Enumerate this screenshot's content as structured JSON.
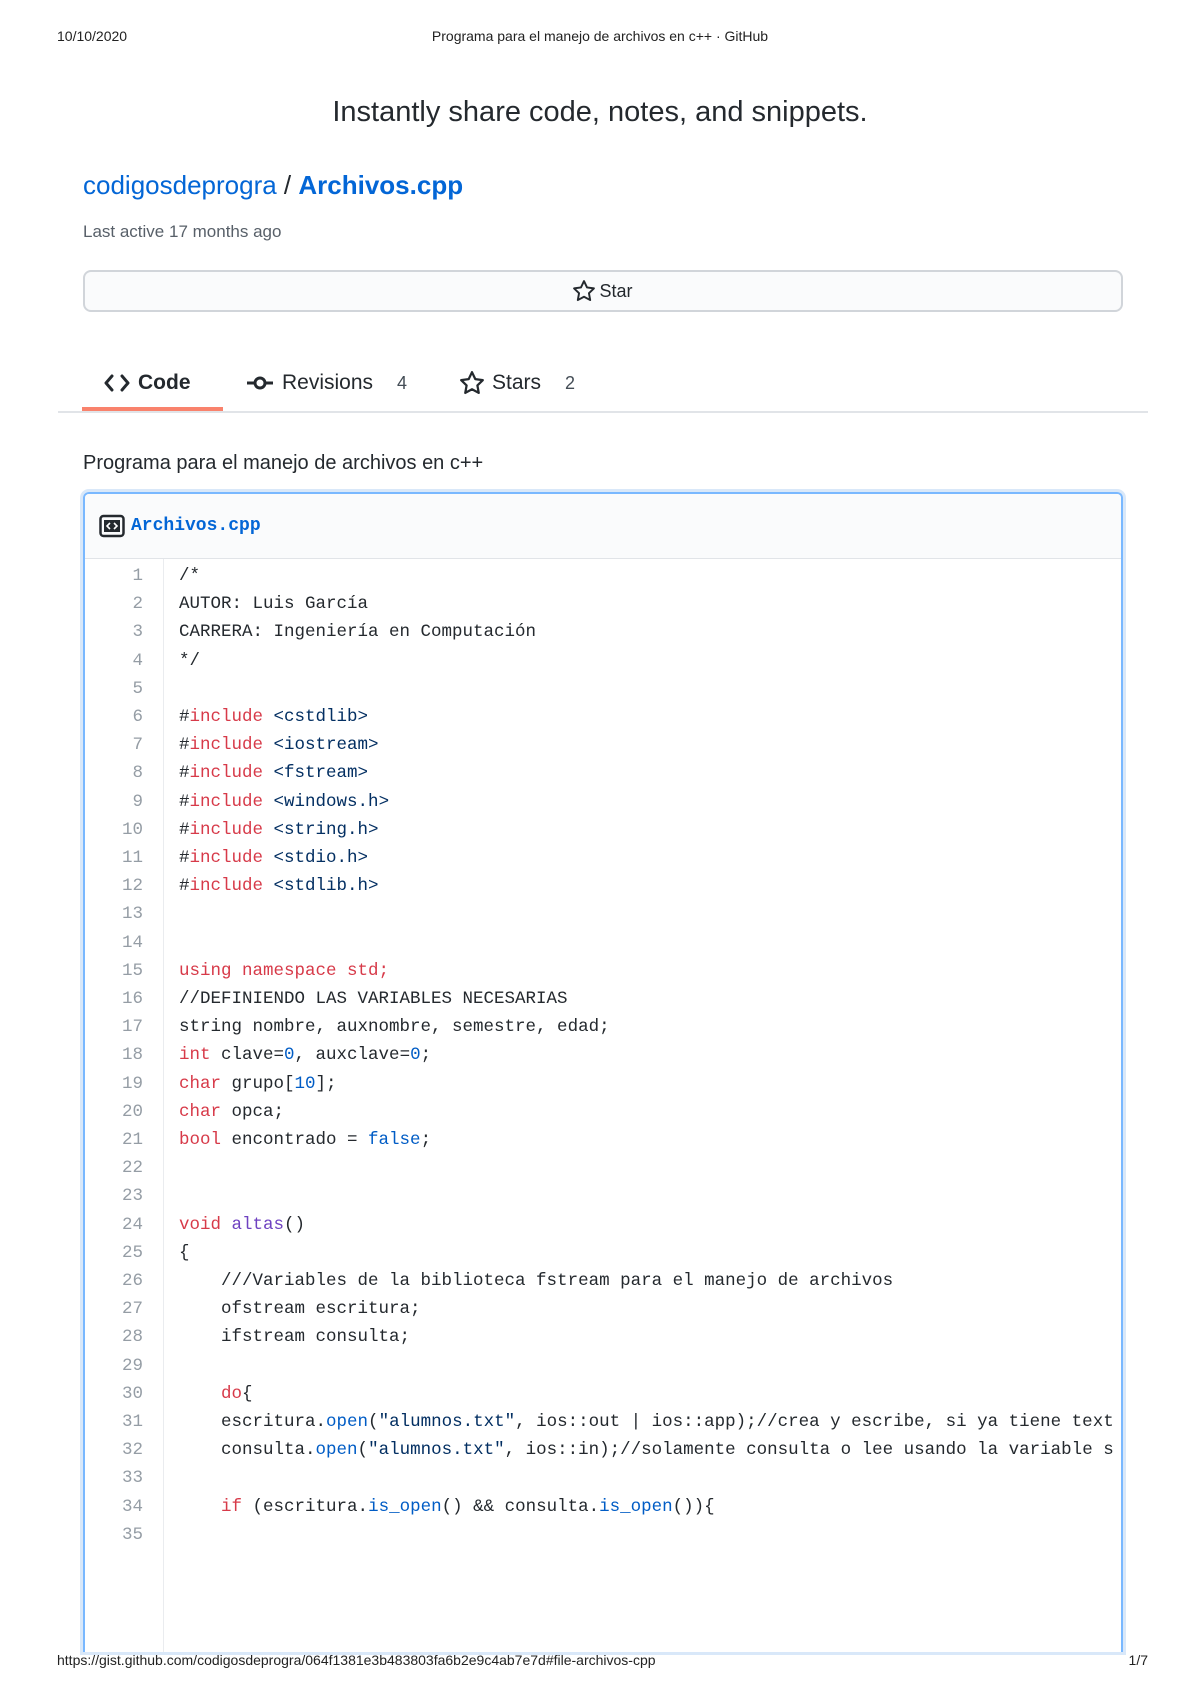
{
  "print_header": {
    "date": "10/10/2020",
    "title": "Programa para el manejo de archivos en c++ · GitHub"
  },
  "print_footer": {
    "url": "https://gist.github.com/codigosdeprogra/064f1381e3b483803fa6b2e9c4ab7e7d#file-archivos-cpp",
    "page": "1/7"
  },
  "tagline": "Instantly share code, notes, and snippets.",
  "gist": {
    "owner": "codigosdeprogra",
    "separator": " / ",
    "filename": "Archivos.cpp",
    "last_active": "Last active 17 months ago"
  },
  "star_button": {
    "label": "Star",
    "icon": "star-icon"
  },
  "tabs": [
    {
      "label": "Code",
      "icon": "code-icon",
      "count": ""
    },
    {
      "label": "Revisions",
      "icon": "git-commit-icon",
      "count": "4"
    },
    {
      "label": "Stars",
      "icon": "star-icon",
      "count": "2"
    }
  ],
  "description": "Programa para el manejo de archivos en c++",
  "file": {
    "name": "Archivos.cpp",
    "icon": "file-code-icon"
  },
  "colors": {
    "link": "#0366d6",
    "keyword": "#d73a49",
    "string": "#032f62",
    "tab_underline": "#f9826c",
    "focus_border": "#79b8ff"
  },
  "code_lines": [
    {
      "n": "1",
      "t": [
        [
          "c",
          "/*"
        ]
      ]
    },
    {
      "n": "2",
      "t": [
        [
          "c",
          "AUTOR: Luis García"
        ]
      ]
    },
    {
      "n": "3",
      "t": [
        [
          "c",
          "CARRERA: Ingeniería en Computación"
        ]
      ]
    },
    {
      "n": "4",
      "t": [
        [
          "c",
          "*/"
        ]
      ]
    },
    {
      "n": "5",
      "t": []
    },
    {
      "n": "6",
      "t": [
        [
          "c",
          "#"
        ],
        [
          "k",
          "include"
        ],
        [
          "c",
          " "
        ],
        [
          "s",
          "<cstdlib>"
        ]
      ]
    },
    {
      "n": "7",
      "t": [
        [
          "c",
          "#"
        ],
        [
          "k",
          "include"
        ],
        [
          "c",
          " "
        ],
        [
          "s",
          "<iostream>"
        ]
      ]
    },
    {
      "n": "8",
      "t": [
        [
          "c",
          "#"
        ],
        [
          "k",
          "include"
        ],
        [
          "c",
          " "
        ],
        [
          "s",
          "<fstream>"
        ]
      ]
    },
    {
      "n": "9",
      "t": [
        [
          "c",
          "#"
        ],
        [
          "k",
          "include"
        ],
        [
          "c",
          " "
        ],
        [
          "s",
          "<windows.h>"
        ]
      ]
    },
    {
      "n": "10",
      "t": [
        [
          "c",
          "#"
        ],
        [
          "k",
          "include"
        ],
        [
          "c",
          " "
        ],
        [
          "s",
          "<string.h>"
        ]
      ]
    },
    {
      "n": "11",
      "t": [
        [
          "c",
          "#"
        ],
        [
          "k",
          "include"
        ],
        [
          "c",
          " "
        ],
        [
          "s",
          "<stdio.h>"
        ]
      ]
    },
    {
      "n": "12",
      "t": [
        [
          "c",
          "#"
        ],
        [
          "k",
          "include"
        ],
        [
          "c",
          " "
        ],
        [
          "s",
          "<stdlib.h>"
        ]
      ]
    },
    {
      "n": "13",
      "t": []
    },
    {
      "n": "14",
      "t": []
    },
    {
      "n": "15",
      "t": [
        [
          "k",
          "using namespace std;"
        ]
      ]
    },
    {
      "n": "16",
      "t": [
        [
          "c",
          "//DEFINIENDO LAS VARIABLES NECESARIAS"
        ]
      ]
    },
    {
      "n": "17",
      "t": [
        [
          "c",
          "string nombre, auxnombre, semestre, edad;"
        ]
      ]
    },
    {
      "n": "18",
      "t": [
        [
          "k",
          "int"
        ],
        [
          "c",
          " clave="
        ],
        [
          "n",
          "0"
        ],
        [
          "c",
          ", auxclave="
        ],
        [
          "n",
          "0"
        ],
        [
          "c",
          ";"
        ]
      ]
    },
    {
      "n": "19",
      "t": [
        [
          "k",
          "char"
        ],
        [
          "c",
          " grupo["
        ],
        [
          "n",
          "10"
        ],
        [
          "c",
          "];"
        ]
      ]
    },
    {
      "n": "20",
      "t": [
        [
          "k",
          "char"
        ],
        [
          "c",
          " opca;"
        ]
      ]
    },
    {
      "n": "21",
      "t": [
        [
          "k",
          "bool"
        ],
        [
          "c",
          " encontrado = "
        ],
        [
          "n",
          "false"
        ],
        [
          "c",
          ";"
        ]
      ]
    },
    {
      "n": "22",
      "t": []
    },
    {
      "n": "23",
      "t": []
    },
    {
      "n": "24",
      "t": [
        [
          "k",
          "void"
        ],
        [
          "c",
          " "
        ],
        [
          "f",
          "altas"
        ],
        [
          "c",
          "()"
        ]
      ]
    },
    {
      "n": "25",
      "t": [
        [
          "c",
          "{"
        ]
      ]
    },
    {
      "n": "26",
      "t": [
        [
          "c",
          "    ///Variables de la biblioteca fstream para el manejo de archivos"
        ]
      ]
    },
    {
      "n": "27",
      "t": [
        [
          "c",
          "    ofstream escritura;"
        ]
      ]
    },
    {
      "n": "28",
      "t": [
        [
          "c",
          "    ifstream consulta;"
        ]
      ]
    },
    {
      "n": "29",
      "t": []
    },
    {
      "n": "30",
      "t": [
        [
          "c",
          "    "
        ],
        [
          "k",
          "do"
        ],
        [
          "c",
          "{"
        ]
      ]
    },
    {
      "n": "31",
      "t": [
        [
          "c",
          "    escritura."
        ],
        [
          "n",
          "open"
        ],
        [
          "c",
          "("
        ],
        [
          "s",
          "\"alumnos.txt\""
        ],
        [
          "c",
          ", ios::out | ios::app);//crea y escribe, si ya tiene text"
        ]
      ]
    },
    {
      "n": "32",
      "t": [
        [
          "c",
          "    consulta."
        ],
        [
          "n",
          "open"
        ],
        [
          "c",
          "("
        ],
        [
          "s",
          "\"alumnos.txt\""
        ],
        [
          "c",
          ", ios::in);//solamente consulta o lee usando la variable s"
        ]
      ]
    },
    {
      "n": "33",
      "t": []
    },
    {
      "n": "34",
      "t": [
        [
          "c",
          "    "
        ],
        [
          "k",
          "if"
        ],
        [
          "c",
          " (escritura."
        ],
        [
          "n",
          "is_open"
        ],
        [
          "c",
          "() && consulta."
        ],
        [
          "n",
          "is_open"
        ],
        [
          "c",
          "()){"
        ]
      ]
    },
    {
      "n": "35",
      "t": []
    }
  ]
}
